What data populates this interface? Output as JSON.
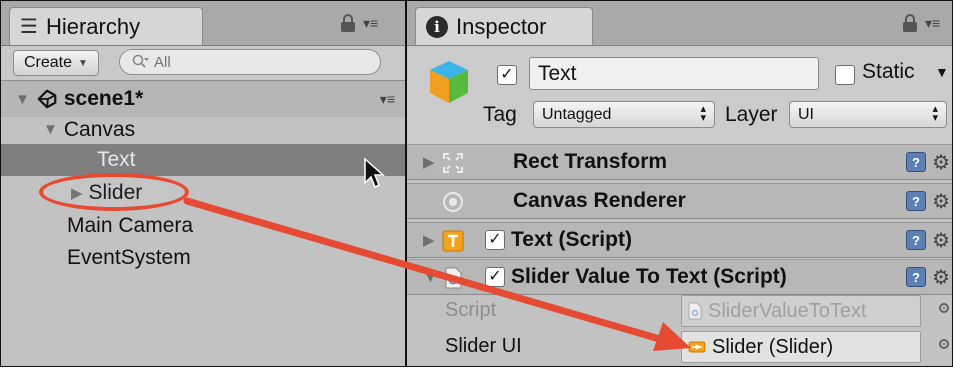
{
  "hierarchy": {
    "tab_label": "Hierarchy",
    "create_label": "Create",
    "search_placeholder": "All",
    "scene_name": "scene1*",
    "items": [
      {
        "label": "Canvas"
      },
      {
        "label": "Text"
      },
      {
        "label": "Slider"
      },
      {
        "label": "Main Camera"
      },
      {
        "label": "EventSystem"
      }
    ]
  },
  "inspector": {
    "tab_label": "Inspector",
    "object_name": "Text",
    "static_label": "Static",
    "tag_label": "Tag",
    "tag_value": "Untagged",
    "layer_label": "Layer",
    "layer_value": "UI",
    "components": [
      {
        "label": "Rect Transform"
      },
      {
        "label": "Canvas Renderer"
      },
      {
        "label": "Text (Script)"
      },
      {
        "label": "Slider Value To Text (Script)"
      }
    ],
    "properties": [
      {
        "label": "Script",
        "value": "SliderValueToText"
      },
      {
        "label": "Slider UI",
        "value": "Slider (Slider)"
      }
    ]
  },
  "colors": {
    "annotation": "#e64a32",
    "selected_row": "#7f7f7f",
    "panel_bg": "#c2c2c2"
  }
}
